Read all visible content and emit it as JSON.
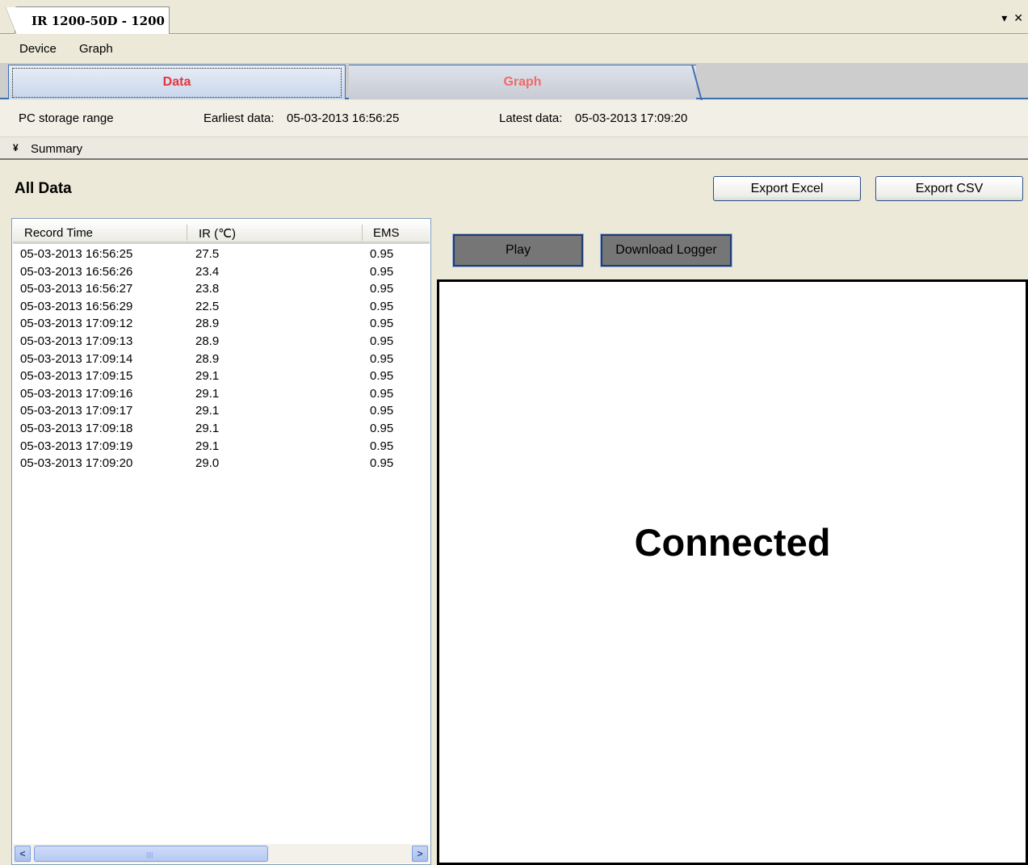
{
  "document_tab": {
    "title": "IR 1200-50D - 1200",
    "dropdown_icon": "▾",
    "close_icon": "✕"
  },
  "menu": {
    "items": [
      "Device",
      "Graph"
    ]
  },
  "tabs": [
    {
      "label": "Data",
      "active": true
    },
    {
      "label": "Graph",
      "active": false
    }
  ],
  "storage": {
    "label": "PC storage range",
    "earliest_label": "Earliest data:",
    "earliest_value": "05-03-2013 16:56:25",
    "latest_label": "Latest data:",
    "latest_value": "05-03-2013 17:09:20"
  },
  "summary": {
    "label": "Summary"
  },
  "main": {
    "title": "All Data",
    "export_excel": "Export Excel",
    "export_csv": "Export CSV",
    "play": "Play",
    "download_logger": "Download Logger",
    "status": "Connected"
  },
  "table": {
    "columns": [
      "Record Time",
      "IR (℃)",
      "EMS"
    ],
    "rows": [
      [
        "05-03-2013 16:56:25",
        "27.5",
        "0.95"
      ],
      [
        "05-03-2013 16:56:26",
        "23.4",
        "0.95"
      ],
      [
        "05-03-2013 16:56:27",
        "23.8",
        "0.95"
      ],
      [
        "05-03-2013 16:56:29",
        "22.5",
        "0.95"
      ],
      [
        "05-03-2013 17:09:12",
        "28.9",
        "0.95"
      ],
      [
        "05-03-2013 17:09:13",
        "28.9",
        "0.95"
      ],
      [
        "05-03-2013 17:09:14",
        "28.9",
        "0.95"
      ],
      [
        "05-03-2013 17:09:15",
        "29.1",
        "0.95"
      ],
      [
        "05-03-2013 17:09:16",
        "29.1",
        "0.95"
      ],
      [
        "05-03-2013 17:09:17",
        "29.1",
        "0.95"
      ],
      [
        "05-03-2013 17:09:18",
        "29.1",
        "0.95"
      ],
      [
        "05-03-2013 17:09:19",
        "29.1",
        "0.95"
      ],
      [
        "05-03-2013 17:09:20",
        "29.0",
        "0.95"
      ]
    ]
  },
  "colors": {
    "tab_text": "#e8333c",
    "accent": "#3d6fb0",
    "dark_button": "#767676"
  }
}
